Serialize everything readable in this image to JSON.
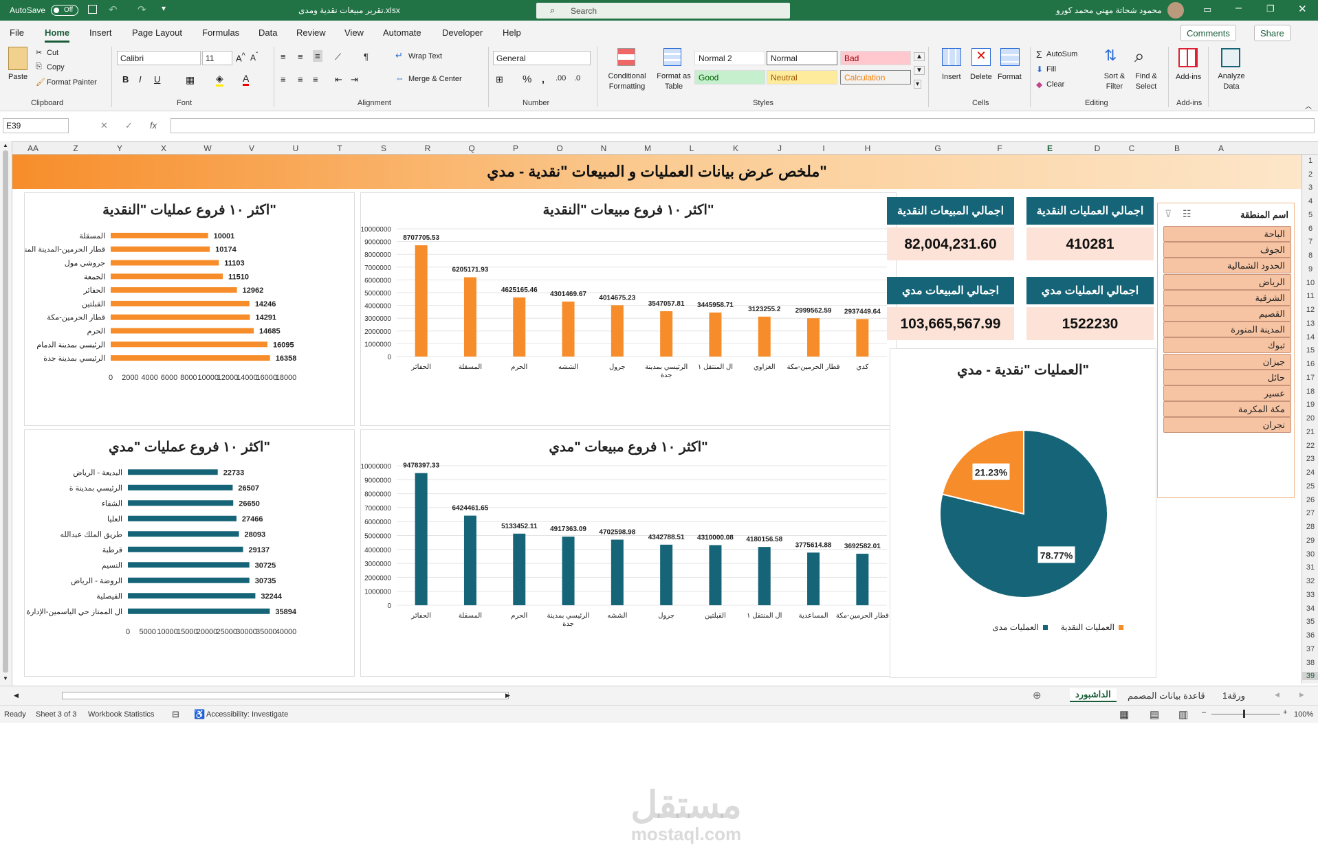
{
  "titlebar": {
    "autosave": "AutoSave",
    "autosave_state": "Off",
    "filename": "تقرير مبيعات نقدية ومدى.xlsx",
    "search_placeholder": "Search",
    "user": "محمود شحاتة مهني محمد كورو"
  },
  "menu": {
    "items": [
      "File",
      "Home",
      "Insert",
      "Page Layout",
      "Formulas",
      "Data",
      "Review",
      "View",
      "Automate",
      "Developer",
      "Help"
    ],
    "comments": "Comments",
    "share": "Share"
  },
  "ribbon": {
    "clipboard": {
      "paste": "Paste",
      "cut": "Cut",
      "copy": "Copy",
      "format_painter": "Format Painter",
      "label": "Clipboard"
    },
    "font": {
      "name": "Calibri",
      "size": "11",
      "label": "Font"
    },
    "alignment": {
      "wrap": "Wrap Text",
      "merge": "Merge & Center",
      "label": "Alignment"
    },
    "number": {
      "format": "General",
      "label": "Number"
    },
    "styles": {
      "conditional": "Conditional Formatting",
      "format_table": "Format as Table",
      "label": "Styles",
      "cells": [
        "Normal 2",
        "Normal",
        "Bad",
        "Good",
        "Neutral",
        "Calculation"
      ]
    },
    "cells": {
      "insert": "Insert",
      "delete": "Delete",
      "format": "Format",
      "label": "Cells"
    },
    "editing": {
      "autosum": "AutoSum",
      "fill": "Fill",
      "clear": "Clear",
      "sort": "Sort & Filter",
      "find": "Find & Select",
      "label": "Editing"
    },
    "addins": {
      "addins": "Add-ins",
      "label": "Add-ins",
      "analyze": "Analyze Data"
    }
  },
  "formula_bar": {
    "cell_ref": "E39",
    "fx": "fx",
    "value": ""
  },
  "columns": [
    "AA",
    "Z",
    "Y",
    "X",
    "W",
    "V",
    "U",
    "T",
    "S",
    "R",
    "Q",
    "P",
    "O",
    "N",
    "M",
    "L",
    "K",
    "J",
    "I",
    "H",
    "G",
    "F",
    "E",
    "D",
    "C",
    "B",
    "A"
  ],
  "rows": [
    "1",
    "2",
    "3",
    "4",
    "5",
    "6",
    "7",
    "8",
    "9",
    "10",
    "11",
    "12",
    "13",
    "14",
    "15",
    "16",
    "17",
    "18",
    "19",
    "20",
    "21",
    "22",
    "23",
    "24",
    "25",
    "26",
    "27",
    "28",
    "29",
    "30",
    "31",
    "32",
    "33",
    "34",
    "35",
    "36",
    "37",
    "38",
    "39"
  ],
  "dashboard": {
    "title": "ملخص عرض بيانات العمليات و المبيعات \"نقدية - مدي\"",
    "kpis": [
      {
        "label": "اجمالي العمليات النقدية",
        "value": "410281"
      },
      {
        "label": "اجمالي المبيعات النقدية",
        "value": "82,004,231.60"
      },
      {
        "label": "اجمالي العمليات مدي",
        "value": "1522230"
      },
      {
        "label": "اجمالي المبيعات مدي",
        "value": "103,665,567.99"
      }
    ],
    "slicer": {
      "title": "اسم المنطقة",
      "items": [
        "الباحة",
        "الجوف",
        "الحدود الشمالية",
        "الرياض",
        "الشرقية",
        "القصيم",
        "المدينة المنورة",
        "تبوك",
        "جيزان",
        "حائل",
        "عسير",
        "مكة المكرمة",
        "نجران"
      ]
    }
  },
  "chart_data": [
    {
      "type": "bar",
      "orientation": "horizontal",
      "title": "اكثر ١٠ فروع عمليات \"النقدية\"",
      "color": "#f78d2a",
      "categories": [
        "المسقلة",
        "قطار الحرمين-المدينة المنورة",
        "جروشي مول",
        "الجمعة",
        "الحفائر",
        "القبلتين",
        "قطار الحرمين-مكة",
        "الحرم",
        "الرئيسي بمدينة الدمام",
        "الرئيسي بمدينة جدة"
      ],
      "values": [
        10001,
        10174,
        11103,
        11510,
        12962,
        14246,
        14291,
        14685,
        16095,
        16358
      ],
      "xlim": [
        0,
        18000
      ],
      "ticks": [
        "0",
        "2000",
        "4000",
        "6000",
        "8000",
        "10000",
        "12000",
        "14000",
        "16000",
        "18000"
      ]
    },
    {
      "type": "bar",
      "title": "اكثر ١٠ فروع مبيعات \"النقدية\"",
      "color": "#f78d2a",
      "categories": [
        "الحفائر",
        "المسقلة",
        "الحرم",
        "الششه",
        "جرول",
        "الرئيسي بمدينة جدة",
        "ال المنتقل ١",
        "الغزاوي",
        "قطار الحرمين-مكة",
        "كدي"
      ],
      "values": [
        8707705.53,
        6205171.93,
        4625165.46,
        4301469.67,
        4014675.23,
        3547057.81,
        3445958.71,
        3123255.2,
        2999562.59,
        2937449.64
      ],
      "labels": [
        "8707705.53",
        "6205171.93",
        "4625165.46",
        "4301469.67",
        "4014675.23",
        "3547057.81",
        "3445958.71",
        "3123255.2",
        "2999562.59",
        "2937449.64"
      ],
      "ylim": [
        0,
        10000000
      ],
      "ticks": [
        "0",
        "1000000",
        "2000000",
        "3000000",
        "4000000",
        "5000000",
        "6000000",
        "7000000",
        "8000000",
        "9000000",
        "10000000"
      ]
    },
    {
      "type": "bar",
      "orientation": "horizontal",
      "title": "اكثر ١٠ فروع عمليات \"مدي\"",
      "color": "#156477",
      "categories": [
        "البديعة - الرياض",
        "الرئيسي بمدينة ة",
        "الشفاء",
        "العليا",
        "طريق الملك عبدالله",
        "قرطبة",
        "النسيم",
        "الروضة - الرياض",
        "الفيصلية",
        "ال الممتاز حي الياسمين-الإدارة العامة"
      ],
      "values": [
        22733,
        26507,
        26650,
        27466,
        28093,
        29137,
        30725,
        30735,
        32244,
        35894
      ],
      "xlim": [
        0,
        40000
      ],
      "ticks": [
        "0",
        "5000",
        "10000",
        "15000",
        "20000",
        "25000",
        "30000",
        "35000",
        "40000"
      ]
    },
    {
      "type": "bar",
      "title": "اكثر ١٠ فروع مبيعات \"مدي\"",
      "color": "#156477",
      "categories": [
        "الحفائر",
        "المسقلة",
        "الحرم",
        "الرئيسي بمدينة جدة",
        "الششه",
        "جرول",
        "القبلتين",
        "ال المنتقل ١",
        "المساعدية",
        "قطار الحرمين-مكة"
      ],
      "values": [
        9478397.33,
        6424461.65,
        5133452.11,
        4917363.09,
        4702598.98,
        4342788.51,
        4310000.08,
        4180156.58,
        3775614.88,
        3692582.01
      ],
      "labels": [
        "9478397.33",
        "6424461.65",
        "5133452.11",
        "4917363.09",
        "4702598.98",
        "4342788.51",
        "4310000.08",
        "4180156.58",
        "3775614.88",
        "3692582.01"
      ],
      "ylim": [
        0,
        10000000
      ],
      "ticks": [
        "0",
        "1000000",
        "2000000",
        "3000000",
        "4000000",
        "5000000",
        "6000000",
        "7000000",
        "8000000",
        "9000000",
        "10000000"
      ]
    },
    {
      "type": "pie",
      "title": "العمليات \"نقدية - مدي\"",
      "slices": [
        {
          "name": "العمليات مدى",
          "value": 78.77,
          "label": "78.77%",
          "color": "#156477"
        },
        {
          "name": "العمليات النقدية",
          "value": 21.23,
          "label": "21.23%",
          "color": "#f78d2a"
        }
      ]
    }
  ],
  "sheets": {
    "tabs": [
      "الداشبورد",
      "قاعدة بيانات المصمم",
      "ورقة1"
    ],
    "active": "الداشبورد"
  },
  "status": {
    "ready": "Ready",
    "sheet": "Sheet 3 of 3",
    "stats": "Workbook Statistics",
    "accessibility": "Accessibility: Investigate",
    "zoom": "100%"
  },
  "watermark": {
    "arabic": "مستقل",
    "latin": "mostaql.com"
  }
}
